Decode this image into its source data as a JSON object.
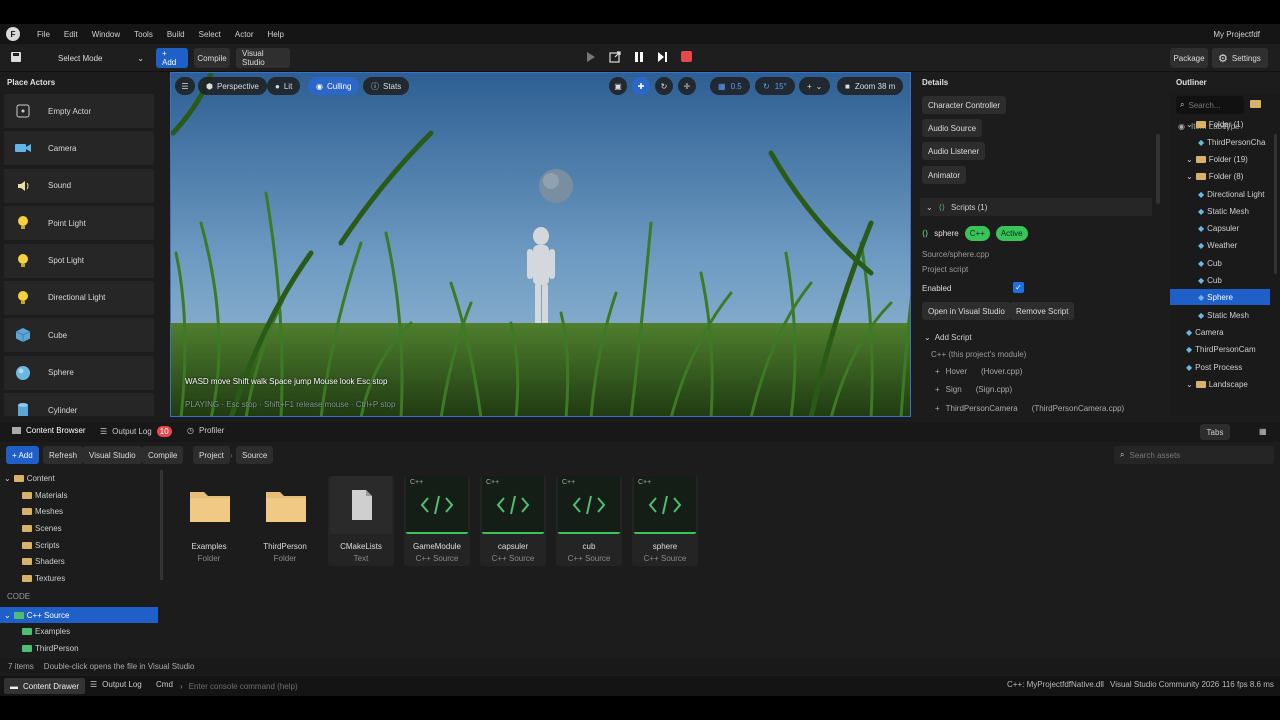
{
  "menu": {
    "logo": "F",
    "items": [
      "File",
      "Edit",
      "Window",
      "Tools",
      "Build",
      "Select",
      "Actor",
      "Help"
    ],
    "project_name": "My Projectfdf"
  },
  "toolbar": {
    "select_mode": "Select Mode",
    "add": "+ Add",
    "compile": "Compile",
    "visual_studio": "Visual Studio",
    "package": "Package",
    "settings": "Settings"
  },
  "place_actors": {
    "title": "Place Actors",
    "items": [
      {
        "label": "Empty Actor",
        "icon": "empty-actor-icon"
      },
      {
        "label": "Camera",
        "icon": "camera-icon"
      },
      {
        "label": "Sound",
        "icon": "sound-icon"
      },
      {
        "label": "Point Light",
        "icon": "point-light-icon"
      },
      {
        "label": "Spot Light",
        "icon": "spot-light-icon"
      },
      {
        "label": "Directional Light",
        "icon": "directional-light-icon"
      },
      {
        "label": "Cube",
        "icon": "cube-icon"
      },
      {
        "label": "Sphere",
        "icon": "sphere-icon"
      },
      {
        "label": "Cylinder",
        "icon": "cylinder-icon"
      }
    ]
  },
  "viewport": {
    "perspective": "Perspective",
    "lit": "Lit",
    "culling": "Culling",
    "stats": "Stats",
    "snap_value": "0.5",
    "rotation_snap": "15°",
    "camera_speed": "Zoom 38 m",
    "hint_controls": "WASD move   Shift walk   Space jump   Mouse look   Esc stop",
    "hint_playing": "PLAYING · Esc stop · Shift+F1 release mouse · Ctrl+P stop"
  },
  "details": {
    "title": "Details",
    "components": [
      "Character Controller",
      "Audio Source",
      "Audio Listener",
      "Animator"
    ],
    "scripts_header": "Scripts (1)",
    "script_name": "sphere",
    "badge_lang": "C++",
    "badge_status": "Active",
    "script_path": "Source/sphere.cpp",
    "script_kind": "Project script",
    "enabled_label": "Enabled",
    "enabled": true,
    "open_vs": "Open in Visual Studio",
    "remove_script": "Remove Script",
    "add_script": "Add Script",
    "module_label": "C++ (this project's module)",
    "script_options": [
      {
        "name": "Hover",
        "file": "(Hover.cpp)"
      },
      {
        "name": "Sign",
        "file": "(Sign.cpp)"
      },
      {
        "name": "ThirdPersonCamera",
        "file": "(ThirdPersonCamera.cpp)"
      }
    ]
  },
  "outliner": {
    "title": "Outliner",
    "search_placeholder": "Search...",
    "header_item": "Item Label",
    "header_type": "Type",
    "rows": [
      {
        "label": "Folder (1)",
        "kind": "folder"
      },
      {
        "label": "ThirdPersonCha",
        "kind": "item"
      },
      {
        "label": "Folder (19)",
        "kind": "folder"
      },
      {
        "label": "Folder (8)",
        "kind": "folder"
      },
      {
        "label": "Directional Light",
        "kind": "item"
      },
      {
        "label": "Static Mesh",
        "kind": "item"
      },
      {
        "label": "Capsuler",
        "kind": "item"
      },
      {
        "label": "Weather",
        "kind": "item"
      },
      {
        "label": "Cub",
        "kind": "item"
      },
      {
        "label": "Cub",
        "kind": "item"
      },
      {
        "label": "Sphere",
        "kind": "item"
      },
      {
        "label": "Static Mesh",
        "kind": "item"
      },
      {
        "label": "Camera",
        "kind": "item"
      },
      {
        "label": "ThirdPersonCam",
        "kind": "item"
      },
      {
        "label": "Post Process",
        "kind": "item"
      },
      {
        "label": "Landscape",
        "kind": "folder"
      }
    ]
  },
  "bottom_tabs": {
    "content_browser": "Content Browser",
    "output_log": "Output Log",
    "output_count": "10",
    "profiler": "Profiler",
    "tabs": "Tabs"
  },
  "content_toolbar": {
    "add": "+ Add",
    "refresh": "Refresh",
    "visual_studio": "Visual Studio",
    "compile": "Compile",
    "crumb_project": "Project",
    "crumb_source": "Source",
    "search_placeholder": "Search assets"
  },
  "tree": {
    "root": "Content",
    "folders": [
      "Materials",
      "Meshes",
      "Scenes",
      "Scripts",
      "Shaders",
      "Textures"
    ],
    "code_label": "CODE",
    "cpp_source": "C++ Source",
    "cpp_children": [
      "Examples",
      "ThirdPerson"
    ]
  },
  "assets": [
    {
      "name": "Examples",
      "type": "Folder",
      "kind": "folder"
    },
    {
      "name": "ThirdPerson",
      "type": "Folder",
      "kind": "folder"
    },
    {
      "name": "CMakeLists",
      "type": "Text",
      "kind": "text"
    },
    {
      "name": "GameModule",
      "type": "C++ Source",
      "kind": "cpp"
    },
    {
      "name": "capsuler",
      "type": "C++ Source",
      "kind": "cpp"
    },
    {
      "name": "cub",
      "type": "C++ Source",
      "kind": "cpp"
    },
    {
      "name": "sphere",
      "type": "C++ Source",
      "kind": "cpp"
    }
  ],
  "status": {
    "items_count": "7 items",
    "hint": "Double-click opens the file in Visual Studio"
  },
  "console": {
    "content_drawer": "Content Drawer",
    "output_log": "Output Log",
    "cmd": "Cmd",
    "placeholder": "Enter console command (help)",
    "dll": "C++: MyProjectfdfNative.dll",
    "ide": "Visual Studio Community 2026",
    "fps": "116 fps  8.6 ms"
  },
  "colors": {
    "accent": "#1f5fc8",
    "badge_green": "#39c45a",
    "folder": "#d8b26a",
    "record": "#e5484d"
  }
}
